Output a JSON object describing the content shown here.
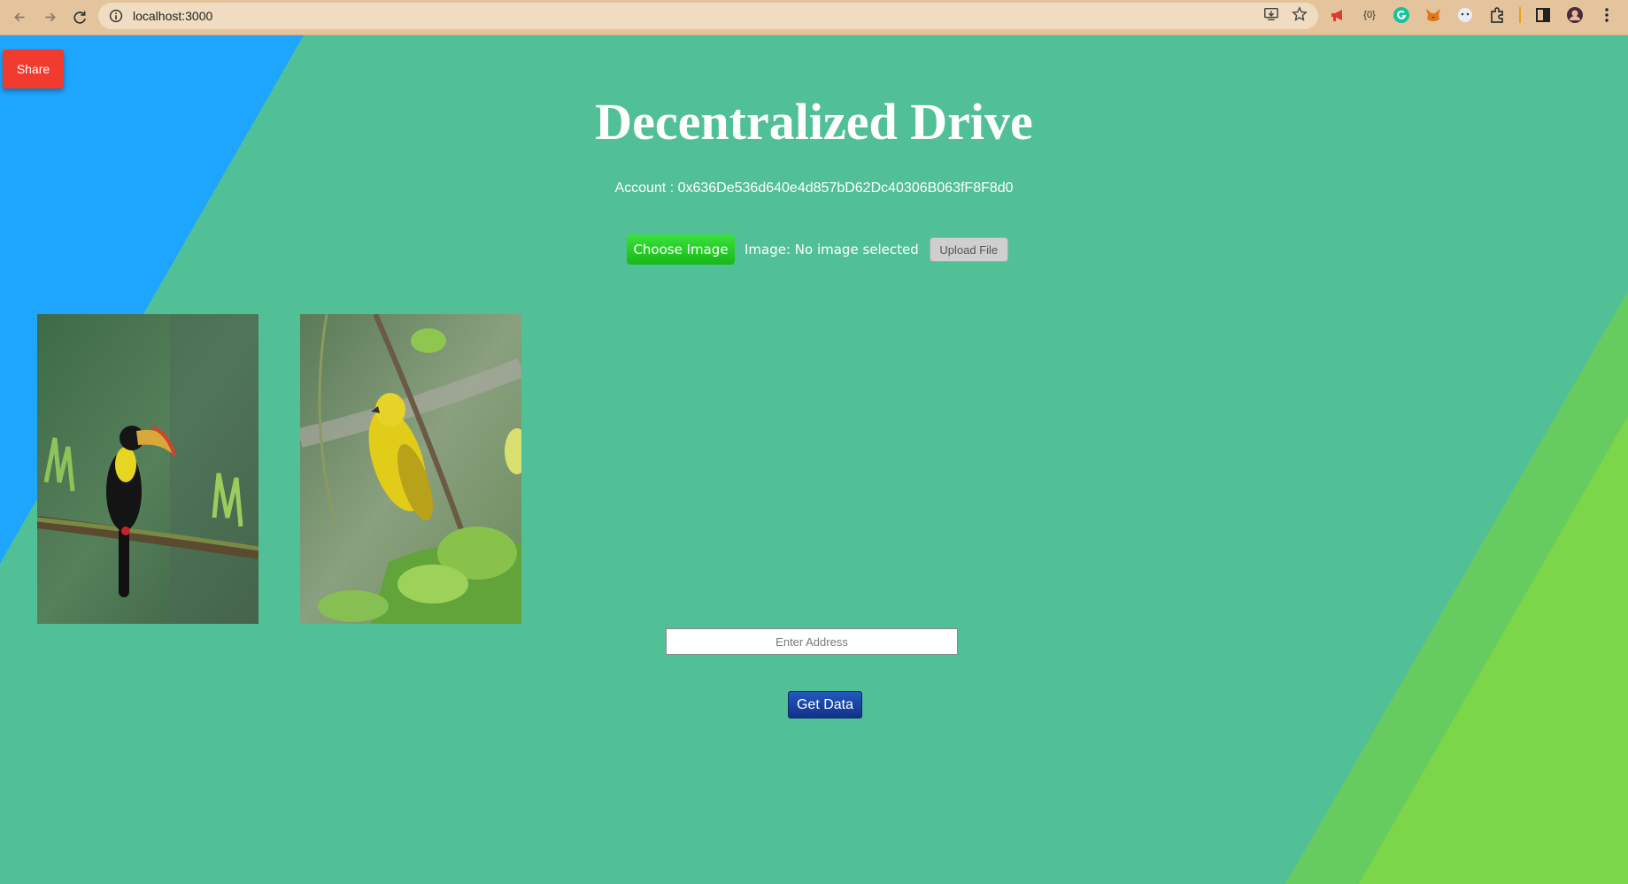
{
  "browser": {
    "url": "localhost:3000",
    "ext_label_bracket": "{0}"
  },
  "colors": {
    "page_bg": "#52c096",
    "blue_shape": "#1ea6ff",
    "green_shape": "#6fcf5d",
    "share_red": "#f23b2f",
    "choose_green": "#22c722",
    "getdata_blue": "#1845a3"
  },
  "share": {
    "label": "Share"
  },
  "header": {
    "title": "Decentralized Drive",
    "account": "Account : 0x636De536d640e4d857bD62Dc40306B063fF8F8d0"
  },
  "upload": {
    "choose_label": "Choose Image",
    "status": "Image: No image selected",
    "upload_label": "Upload File"
  },
  "gallery": {
    "items": [
      {
        "icon": "toucan-image"
      },
      {
        "icon": "yellow-bird-image"
      }
    ]
  },
  "address": {
    "placeholder": "Enter Address",
    "value": ""
  },
  "getdata": {
    "label": "Get Data"
  }
}
